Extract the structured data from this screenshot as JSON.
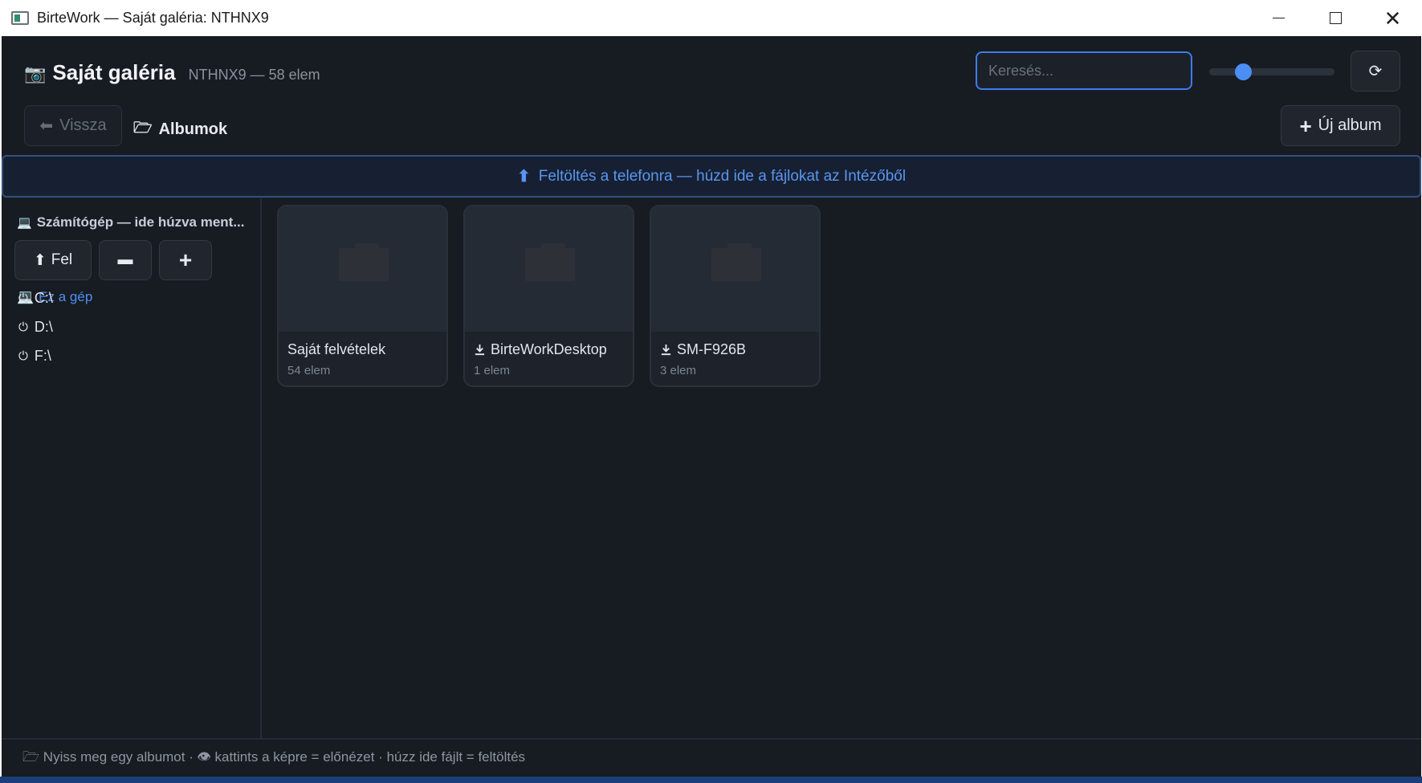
{
  "window": {
    "title": "BirteWork — Saját galéria: NTHNX9",
    "minimize_icon": "minimize-icon",
    "maximize_icon": "maximize-icon",
    "close_icon": "close-icon"
  },
  "header": {
    "icon": "camera-icon",
    "title": "Saját galéria",
    "subtitle": "NTHNX9 — 58 elem",
    "search_placeholder": "Keresés...",
    "search_value": "",
    "zoom_level": 0.24,
    "refresh_icon": "refresh-icon",
    "refresh_glyph": "⟳"
  },
  "nav": {
    "back_label": "Vissza",
    "back_glyph": "⬅",
    "crumb_label": "Albumok",
    "crumb_glyph": "🗁",
    "new_album_label": "Új album",
    "new_album_glyph": "+"
  },
  "upload": {
    "glyph": "⬆",
    "text": "Feltöltés a telefonra — húzd ide a fájlokat az Intézőből"
  },
  "sidebar": {
    "header": "Számítógép — ide húzva ment...",
    "header_glyph": "💻",
    "up_label": "Fel",
    "up_glyph": "⬆",
    "drive_glyph": "▬",
    "add_glyph": "+",
    "this_pc": "Ez a gép",
    "drives": [
      {
        "label": "C:\\",
        "glyph": "⏻"
      },
      {
        "label": "D:\\",
        "glyph": "⏻"
      },
      {
        "label": "F:\\",
        "glyph": "⏻"
      }
    ]
  },
  "albums": [
    {
      "name": "Saját felvételek",
      "count": "54 elem",
      "icon": ""
    },
    {
      "name": "BirteWorkDesktop",
      "count": "1 elem",
      "icon": "download-icon"
    },
    {
      "name": "SM-F926B",
      "count": "3 elem",
      "icon": "download-icon"
    }
  ],
  "status": {
    "text": "🗁 Nyiss meg egy albumot · 👁 kattints a képre = előnézet · húzz ide fájlt = feltöltés"
  },
  "colors": {
    "background": "#171b22",
    "accent": "#4c8df6",
    "upload_text": "#5a95f0"
  }
}
